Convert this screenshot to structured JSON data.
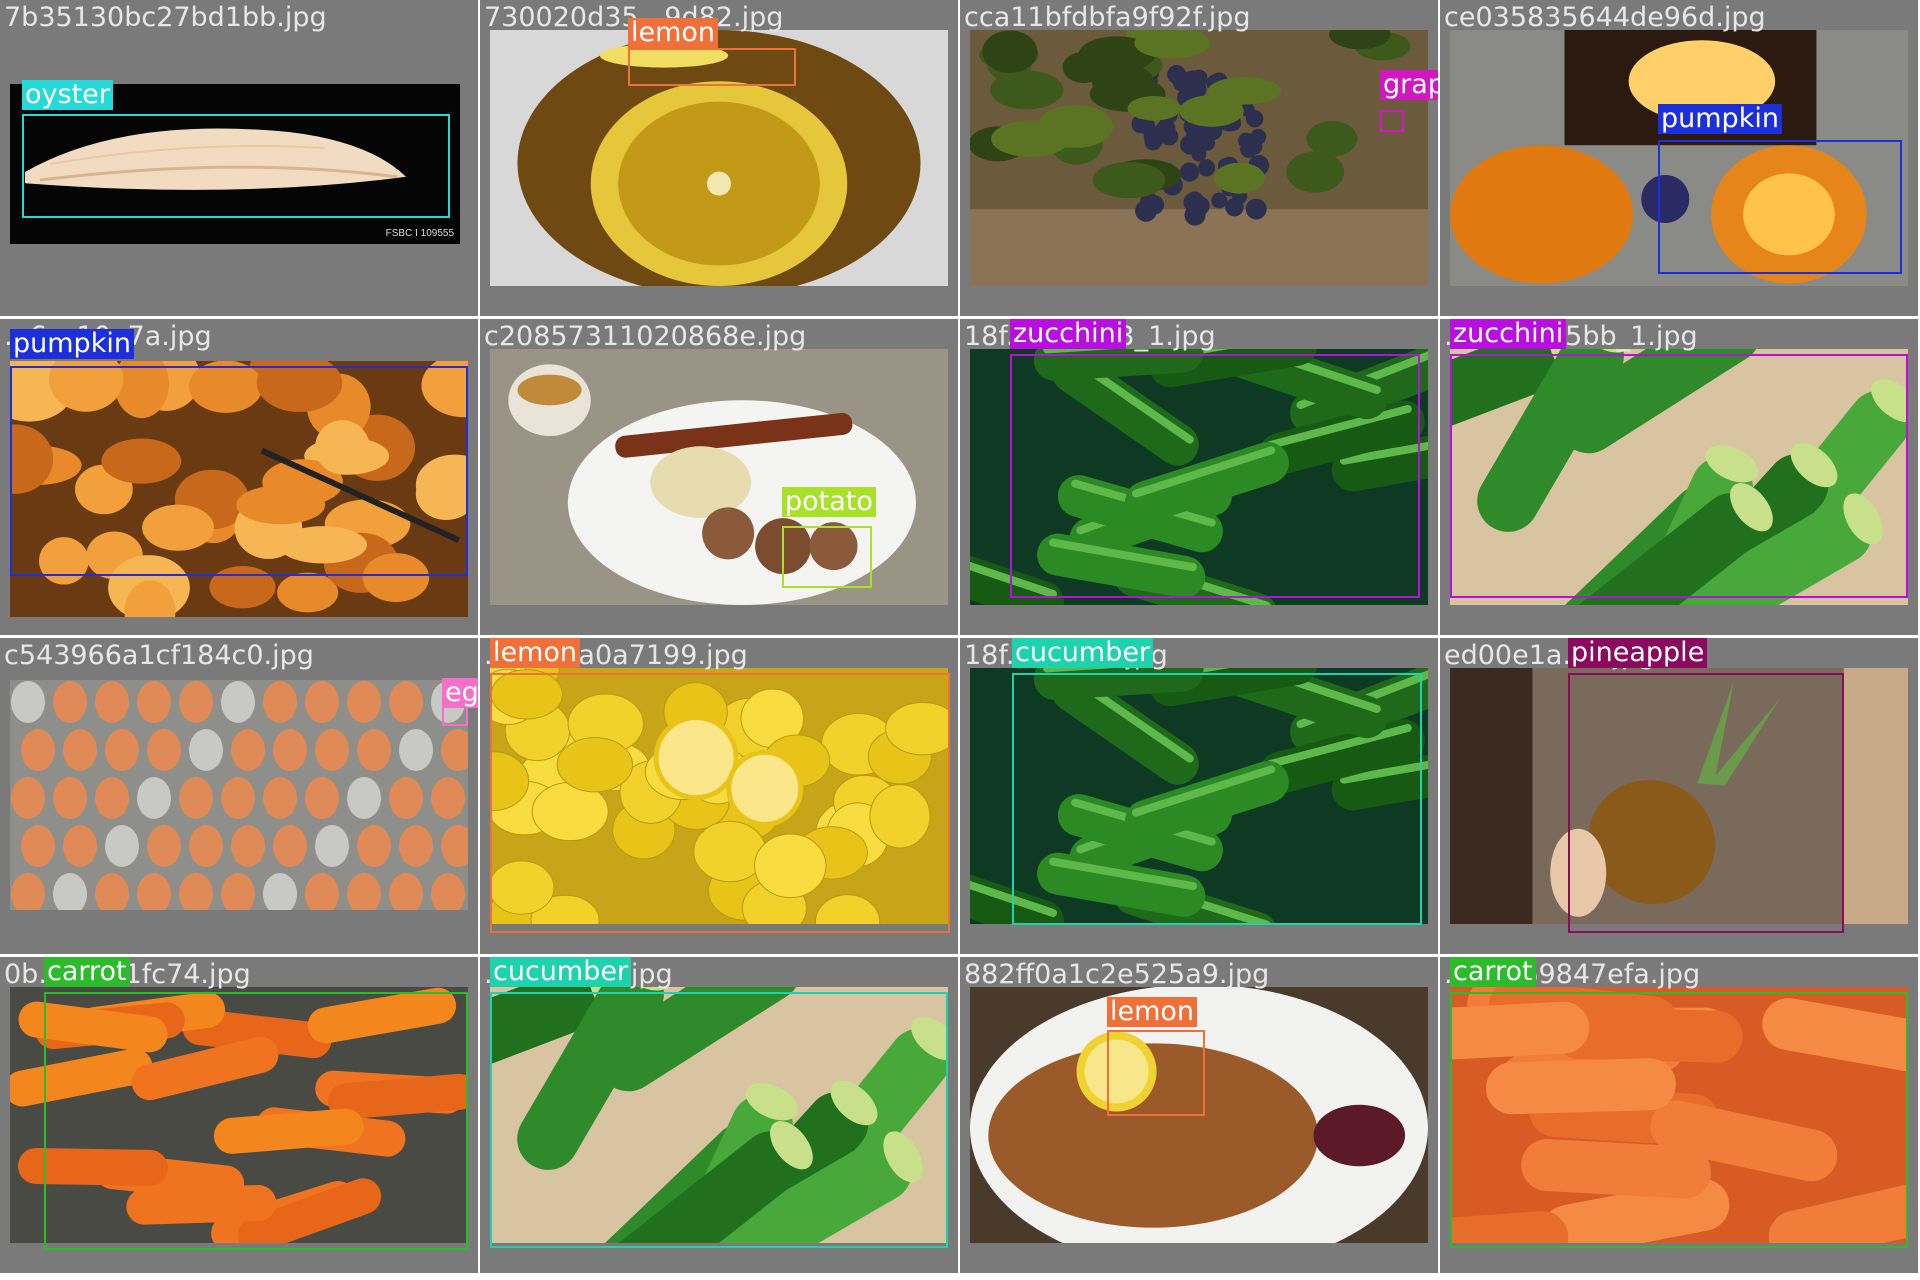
{
  "tiles": [
    {
      "filename": "7b35130bc27bd1bb.jpg",
      "scene": "oyster",
      "caption": "FSBC I 109555",
      "label": "oyster",
      "label_bg": "#26d9d9",
      "label_fg": "#ffffff",
      "box_color": "#26d9d9"
    },
    {
      "filename": "730020d35...9d82.jpg",
      "scene": "lemon-tea",
      "label": "lemon",
      "label_bg": "#f0703a",
      "label_fg": "#ffffff",
      "box_color": "#f0703a"
    },
    {
      "filename": "cca11bfdbfa9f92f.jpg",
      "scene": "grapes",
      "label": "grape",
      "label_bg": "#d018c0",
      "label_fg": "#ffffff",
      "box_color": "#d018c0"
    },
    {
      "filename": "ce035835644de96d.jpg",
      "scene": "pumpkin-carved",
      "label": "pumpkin",
      "label_bg": "#1c2fd8",
      "label_fg": "#ffffff",
      "box_color": "#1c2fd8"
    },
    {
      "filename": "...6cc10e7a.jpg",
      "scene": "pumpkin-pieces",
      "label": "pumpkin",
      "label_bg": "#1c2fd8",
      "label_fg": "#ffffff",
      "box_color": "#1c2fd8"
    },
    {
      "filename": "c20857311020868e.jpg",
      "scene": "breakfast",
      "label": "potato",
      "label_bg": "#a8e02a",
      "label_fg": "#ffffff",
      "box_color": "#a8e02a"
    },
    {
      "filename": "18f...9db0b3_1.jpg",
      "scene": "zucchini",
      "label": "zucchini",
      "label_bg": "#b80fe0",
      "label_fg": "#ffffff",
      "box_color": "#b80fe0"
    },
    {
      "filename": "...20f1135bb_1.jpg",
      "scene": "zucchini-close",
      "label": "zucchini",
      "label_bg": "#b80fe0",
      "label_fg": "#ffffff",
      "box_color": "#b80fe0"
    },
    {
      "filename": "c543966a1cf184c0.jpg",
      "scene": "eggs",
      "label": "egg",
      "label_bg": "#f270c8",
      "label_fg": "#ffffff",
      "box_color": "#f270c8"
    },
    {
      "filename": "...6b52a0a7199.jpg",
      "scene": "lemons",
      "label": "lemon",
      "label_bg": "#f0703a",
      "label_fg": "#ffffff",
      "box_color": "#f0703a"
    },
    {
      "filename": "18f...db0b3.jpg",
      "scene": "zucchini",
      "label": "cucumber",
      "label_bg": "#1ed2ad",
      "label_fg": "#ffffff",
      "box_color": "#1ed2ad"
    },
    {
      "filename": "ed00e1a...e.jpg",
      "scene": "pineapple",
      "label": "pineapple",
      "label_bg": "#8a0a5e",
      "label_fg": "#ffffff",
      "box_color": "#8a0a5e"
    },
    {
      "filename": "0b...24ef1fc74.jpg",
      "scene": "carrots-pile",
      "label": "carrot",
      "label_bg": "#2bbb2b",
      "label_fg": "#ffffff",
      "box_color": "#2bbb2b"
    },
    {
      "filename": "...f1135bb.jpg",
      "scene": "zucchini-close",
      "label": "cucumber",
      "label_bg": "#1ed2ad",
      "label_fg": "#ffffff",
      "box_color": "#1ed2ad"
    },
    {
      "filename": "882ff0a1c2e525a9.jpg",
      "scene": "schnitzel",
      "label": "lemon",
      "label_bg": "#f0703a",
      "label_fg": "#ffffff",
      "box_color": "#f0703a"
    },
    {
      "filename": "...54669847efa.jpg",
      "scene": "carrots-baby",
      "label": "carrot",
      "label_bg": "#2bbb2b",
      "label_fg": "#ffffff",
      "box_color": "#2bbb2b"
    }
  ]
}
